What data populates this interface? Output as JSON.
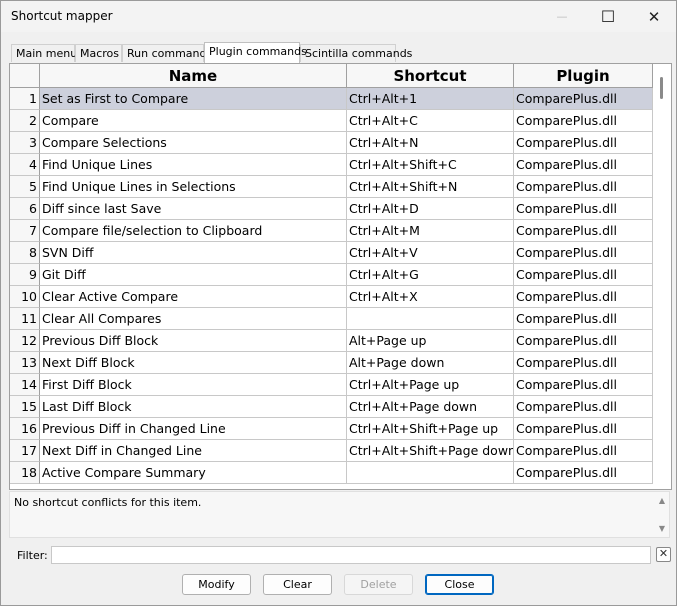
{
  "window": {
    "title": "Shortcut mapper"
  },
  "titlebar": {
    "minimize_glyph": "—",
    "maximize_glyph": "☐",
    "close_glyph": "✕"
  },
  "tabs": [
    {
      "label": "Main menu"
    },
    {
      "label": "Macros"
    },
    {
      "label": "Run commands"
    },
    {
      "label": "Plugin commands"
    },
    {
      "label": "Scintilla commands"
    }
  ],
  "active_tab": "Plugin commands",
  "table": {
    "columns": [
      "Name",
      "Shortcut",
      "Plugin"
    ],
    "selected_row": 1,
    "rows": [
      {
        "num": "1",
        "name": "Set as First to Compare",
        "shortcut": "Ctrl+Alt+1",
        "plugin": "ComparePlus.dll"
      },
      {
        "num": "2",
        "name": "Compare",
        "shortcut": "Ctrl+Alt+C",
        "plugin": "ComparePlus.dll"
      },
      {
        "num": "3",
        "name": "Compare Selections",
        "shortcut": "Ctrl+Alt+N",
        "plugin": "ComparePlus.dll"
      },
      {
        "num": "4",
        "name": "Find Unique Lines",
        "shortcut": "Ctrl+Alt+Shift+C",
        "plugin": "ComparePlus.dll"
      },
      {
        "num": "5",
        "name": "Find Unique Lines in Selections",
        "shortcut": "Ctrl+Alt+Shift+N",
        "plugin": "ComparePlus.dll"
      },
      {
        "num": "6",
        "name": "Diff since last Save",
        "shortcut": "Ctrl+Alt+D",
        "plugin": "ComparePlus.dll"
      },
      {
        "num": "7",
        "name": "Compare file/selection to Clipboard",
        "shortcut": "Ctrl+Alt+M",
        "plugin": "ComparePlus.dll"
      },
      {
        "num": "8",
        "name": "SVN Diff",
        "shortcut": "Ctrl+Alt+V",
        "plugin": "ComparePlus.dll"
      },
      {
        "num": "9",
        "name": "Git Diff",
        "shortcut": "Ctrl+Alt+G",
        "plugin": "ComparePlus.dll"
      },
      {
        "num": "10",
        "name": "Clear Active Compare",
        "shortcut": "Ctrl+Alt+X",
        "plugin": "ComparePlus.dll"
      },
      {
        "num": "11",
        "name": "Clear All Compares",
        "shortcut": "",
        "plugin": "ComparePlus.dll"
      },
      {
        "num": "12",
        "name": "Previous Diff Block",
        "shortcut": "Alt+Page up",
        "plugin": "ComparePlus.dll"
      },
      {
        "num": "13",
        "name": "Next Diff Block",
        "shortcut": "Alt+Page down",
        "plugin": "ComparePlus.dll"
      },
      {
        "num": "14",
        "name": "First Diff Block",
        "shortcut": "Ctrl+Alt+Page up",
        "plugin": "ComparePlus.dll"
      },
      {
        "num": "15",
        "name": "Last Diff Block",
        "shortcut": "Ctrl+Alt+Page down",
        "plugin": "ComparePlus.dll"
      },
      {
        "num": "16",
        "name": "Previous Diff in Changed Line",
        "shortcut": "Ctrl+Alt+Shift+Page up",
        "plugin": "ComparePlus.dll"
      },
      {
        "num": "17",
        "name": "Next Diff in Changed Line",
        "shortcut": "Ctrl+Alt+Shift+Page down",
        "plugin": "ComparePlus.dll"
      },
      {
        "num": "18",
        "name": "Active Compare Summary",
        "shortcut": "",
        "plugin": "ComparePlus.dll"
      }
    ]
  },
  "conflict": {
    "text": "No shortcut conflicts for this item."
  },
  "filter": {
    "label": "Filter:",
    "value": "",
    "clear_glyph": "✕"
  },
  "buttons": {
    "modify": "Modify",
    "clear": "Clear",
    "delete": "Delete",
    "close": "Close"
  },
  "colors": {
    "selected_row": "#cdd0dc",
    "default_button_border": "#0067c0"
  }
}
